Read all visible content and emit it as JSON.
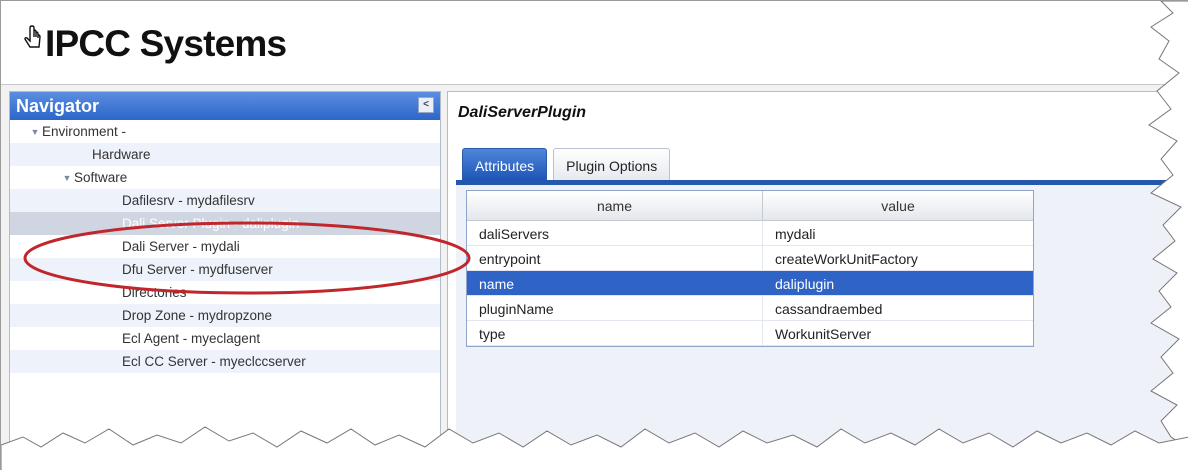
{
  "app": {
    "logo_text": "IPCC Systems"
  },
  "navigator": {
    "title": "Navigator",
    "collapse_label": "<",
    "items": [
      {
        "label": "Environment - "
      },
      {
        "label": "Hardware"
      },
      {
        "label": "Software"
      },
      {
        "label": "Dafilesrv - mydafilesrv"
      },
      {
        "label": "Dali Server Plugin - daliplugin"
      },
      {
        "label": "Dali Server - mydali"
      },
      {
        "label": "Dfu Server - mydfuserver"
      },
      {
        "label": "Directories"
      },
      {
        "label": "Drop Zone - mydropzone"
      },
      {
        "label": "Ecl Agent - myeclagent"
      },
      {
        "label": "Ecl CC Server - myeclccserver"
      }
    ]
  },
  "main": {
    "title": "DaliServerPlugin",
    "tabs": [
      {
        "label": "Attributes"
      },
      {
        "label": "Plugin Options"
      }
    ],
    "grid": {
      "columns": [
        "name",
        "value"
      ],
      "rows": [
        {
          "name": "daliServers",
          "value": "mydali"
        },
        {
          "name": "entrypoint",
          "value": "createWorkUnitFactory"
        },
        {
          "name": "name",
          "value": "daliplugin"
        },
        {
          "name": "pluginName",
          "value": "cassandraembed"
        },
        {
          "name": "type",
          "value": "WorkunitServer"
        }
      ]
    }
  },
  "colors": {
    "nav_header": "#2c66c9",
    "selection": "#2f63c5",
    "annotation": "#c0262b"
  },
  "icons": [
    "hand-cursor-icon",
    "collapse-icon",
    "expand-arrow-icon"
  ]
}
